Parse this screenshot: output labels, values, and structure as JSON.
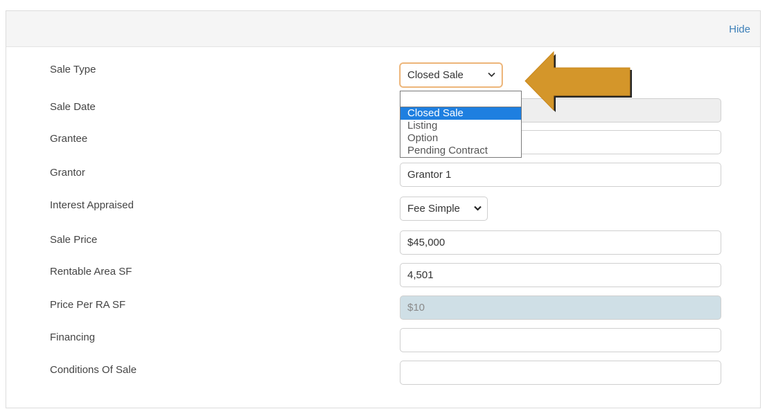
{
  "header": {
    "hide_label": "Hide"
  },
  "fields": {
    "sale_type": {
      "label": "Sale Type",
      "value": "Closed Sale"
    },
    "sale_date": {
      "label": "Sale Date",
      "value": ""
    },
    "grantee": {
      "label": "Grantee",
      "value": ""
    },
    "grantor": {
      "label": "Grantor",
      "value": "Grantor 1"
    },
    "interest_appraised": {
      "label": "Interest Appraised",
      "value": "Fee Simple"
    },
    "sale_price": {
      "label": "Sale Price",
      "value": "$45,000"
    },
    "rentable_area": {
      "label": "Rentable Area SF",
      "value": "4,501"
    },
    "price_per_ra": {
      "label": "Price Per RA SF",
      "value": "$10"
    },
    "financing": {
      "label": "Financing",
      "value": ""
    },
    "conditions": {
      "label": "Conditions Of Sale",
      "value": ""
    }
  },
  "sale_type_options": [
    "",
    "Closed Sale",
    "Listing",
    "Option",
    "Pending Contract"
  ],
  "icons": {
    "dropdown": "chevron-down-icon",
    "pointer": "arrow-left-icon"
  },
  "colors": {
    "accent_orange": "#d4962a",
    "link_blue": "#3d7fb8",
    "selected_blue": "#1e7fe0"
  }
}
